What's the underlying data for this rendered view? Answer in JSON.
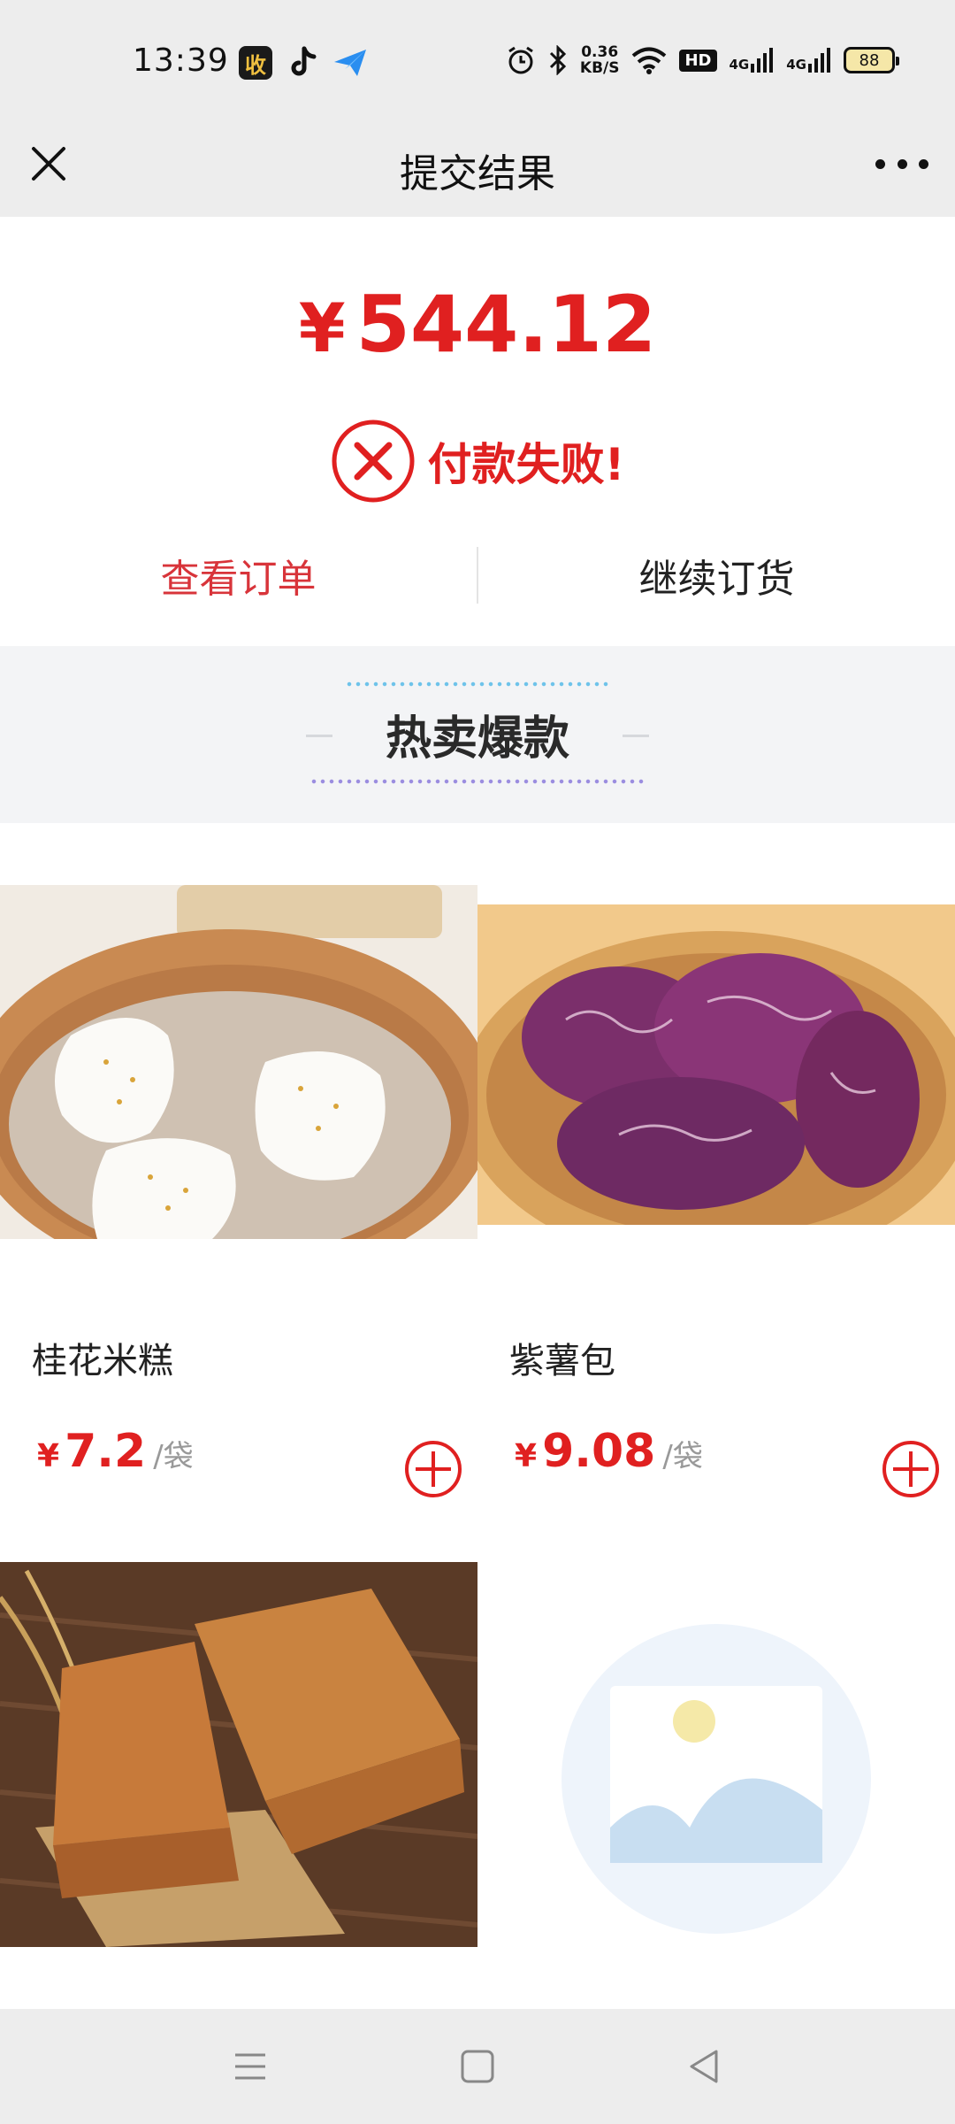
{
  "status_bar": {
    "time": "13:39",
    "app_badge": "收",
    "net_speed_value": "0.36",
    "net_speed_unit": "KB/S",
    "hd_label": "HD",
    "signal_1": "4G",
    "signal_2": "4G",
    "battery": "88"
  },
  "nav": {
    "title": "提交结果"
  },
  "result": {
    "currency": "¥",
    "amount": "544.12",
    "status_text": "付款失败!",
    "actions": {
      "view_order": "查看订单",
      "continue": "继续订货"
    }
  },
  "section": {
    "title": "热卖爆款"
  },
  "products": [
    {
      "name": "桂花米糕",
      "currency": "¥",
      "price": "7.2",
      "unit": "/袋",
      "image": "osmanthus-rice-cake"
    },
    {
      "name": "紫薯包",
      "currency": "¥",
      "price": "9.08",
      "unit": "/袋",
      "image": "purple-sweet-potato-bun"
    },
    {
      "name": "",
      "image": "sponge-cake"
    },
    {
      "name": "",
      "image": "placeholder"
    }
  ],
  "colors": {
    "accent_red": "#e02020",
    "link_red": "#d8343a",
    "bar_gray": "#ededed",
    "banner_gray": "#f3f4f6"
  },
  "icons": {
    "close": "close-icon",
    "more": "more-icon",
    "fail": "fail-x-circle-icon",
    "add": "add-circle-icon",
    "menu": "menu-icon",
    "home": "home-icon",
    "back": "back-icon"
  }
}
